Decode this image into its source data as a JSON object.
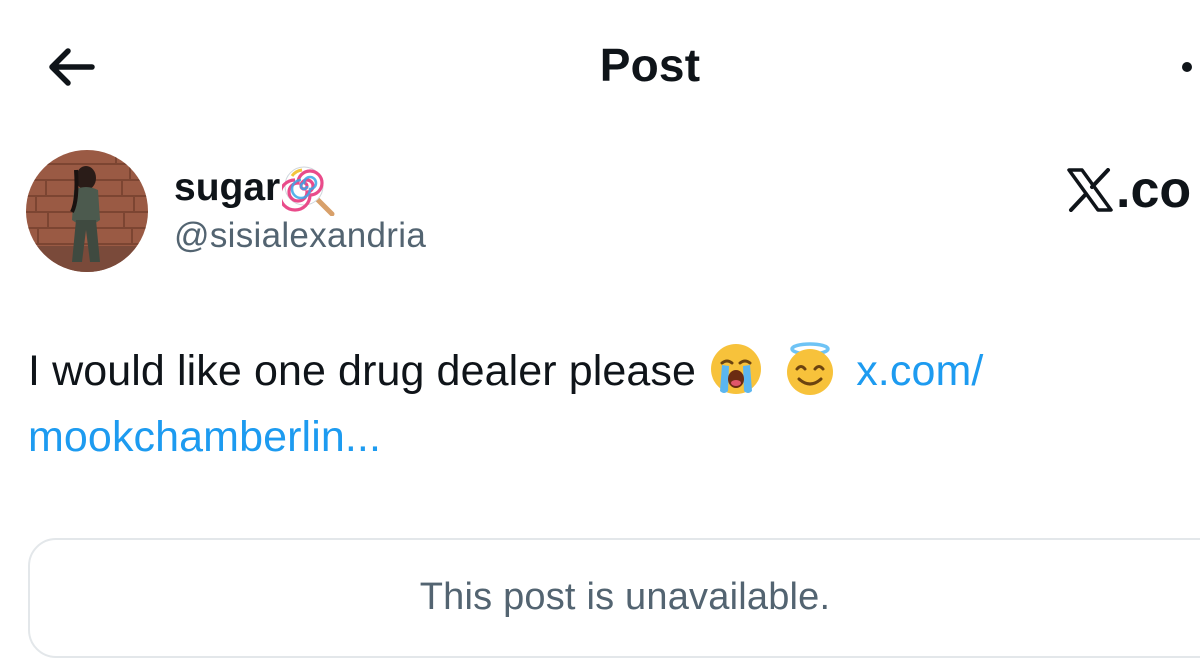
{
  "header": {
    "title": "Post",
    "back_icon": "arrow-left-icon",
    "more_icon": "more-dots-icon"
  },
  "author": {
    "display_name": "sugar",
    "name_emoji": "lollipop-icon",
    "handle": "@sisialexandria",
    "avatar_icon": "avatar"
  },
  "watermark": {
    "logo_icon": "x-logo-icon",
    "text": ".co"
  },
  "post": {
    "text": "I would like one drug dealer please",
    "emojis": [
      "loudly-crying-face-icon",
      "smiling-face-with-halo-icon"
    ],
    "link_part1": "x.com/",
    "link_part2": "mookchamberlin..."
  },
  "quote": {
    "unavailable_text": "This post is unavailable."
  },
  "colors": {
    "text_primary": "#0f1419",
    "text_secondary": "#536471",
    "link": "#1d9bf0",
    "border": "#e3e7ea"
  }
}
